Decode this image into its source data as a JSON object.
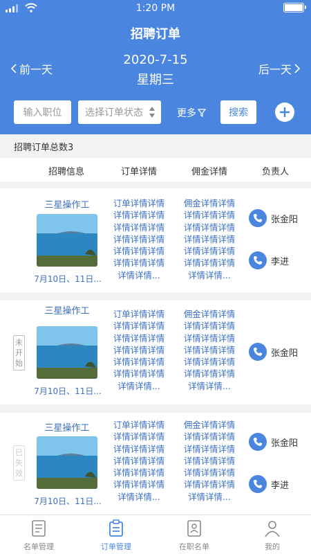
{
  "status_bar": {
    "time": "1:20 PM"
  },
  "header": {
    "title": "招聘订单",
    "prev_label": "前一天",
    "next_label": "后一天",
    "date": "2020-7-15",
    "weekday": "星期三"
  },
  "filters": {
    "job_placeholder": "输入职位",
    "status_placeholder": "选择订单状态",
    "more_label": "更多",
    "search_label": "搜索"
  },
  "summary": {
    "total_label": "招聘订单总数3"
  },
  "columns": [
    "招聘信息",
    "订单详情",
    "佣金详情",
    "负责人"
  ],
  "orders": [
    {
      "title": "三星操作工",
      "date": "7月10日、11日...",
      "status": "",
      "order_detail": "订单详情详情详情详情详情详情详情详情详情详情详情详情详情详情详情详情详情详情详情...",
      "commission_detail": "佣金详情详情详情详情详情详情详情详情详情详情详情详情详情详情详情详情详情详情详情...",
      "people": [
        "张金阳",
        "李进"
      ]
    },
    {
      "title": "三星操作工",
      "date": "7月10日、11日...",
      "status": "未开始",
      "order_detail": "订单详情详情详情详情详情详情详情详情详情详情详情详情详情详情详情详情详情详情详情...",
      "commission_detail": "佣金详情详情详情详情详情详情详情详情详情详情详情详情详情详情详情详情详情详情详情...",
      "people": [
        "张金阳"
      ]
    },
    {
      "title": "三星操作工",
      "date": "7月10日、11日...",
      "status": "已失效",
      "order_detail": "订单详情详情详情详情详情详情详情详情详情详情详情详情详情详情详情详情详情详情详情...",
      "commission_detail": "佣金详情详情详情详情详情详情详情详情详情详情详情详情详情详情详情详情详情详情详情...",
      "people": [
        "张金阳",
        "李进"
      ]
    }
  ],
  "tabs": [
    {
      "label": "名单管理",
      "icon": "list-doc-icon",
      "active": false
    },
    {
      "label": "订单管理",
      "icon": "clipboard-icon",
      "active": true
    },
    {
      "label": "在职名单",
      "icon": "employee-doc-icon",
      "active": false
    },
    {
      "label": "我的",
      "icon": "person-icon",
      "active": false
    }
  ],
  "colors": {
    "primary": "#4a86e0",
    "link": "#3a6fc4"
  }
}
